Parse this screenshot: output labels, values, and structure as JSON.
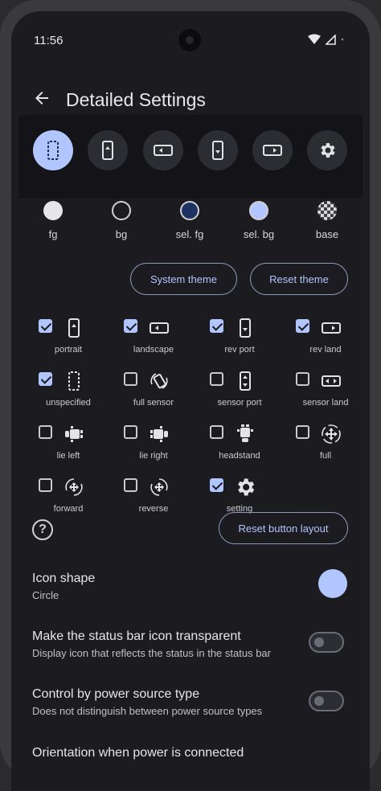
{
  "status_bar": {
    "time": "11:56"
  },
  "app_bar": {
    "title": "Detailed Settings",
    "back_icon": "arrow-back-icon"
  },
  "icon_bar": {
    "items": [
      {
        "icon": "unspecified-icon",
        "active": true
      },
      {
        "icon": "portrait-icon",
        "active": false
      },
      {
        "icon": "landscape-icon",
        "active": false
      },
      {
        "icon": "rev-port-icon",
        "active": false
      },
      {
        "icon": "rev-land-icon",
        "active": false
      },
      {
        "icon": "gear-icon",
        "active": false
      }
    ]
  },
  "colors": [
    {
      "label": "fg",
      "color": "#e6e6ea"
    },
    {
      "label": "bg",
      "color": "#1c1c20"
    },
    {
      "label": "sel. fg",
      "color": "#1d3263"
    },
    {
      "label": "sel. bg",
      "color": "#b1c5ff"
    },
    {
      "label": "base",
      "color": "checker"
    }
  ],
  "theme_buttons": {
    "system": "System theme",
    "reset": "Reset theme"
  },
  "orientations": [
    {
      "label": "portrait",
      "checked": true,
      "icon": "portrait-icon"
    },
    {
      "label": "landscape",
      "checked": true,
      "icon": "landscape-icon"
    },
    {
      "label": "rev port",
      "checked": true,
      "icon": "rev-port-icon"
    },
    {
      "label": "rev land",
      "checked": true,
      "icon": "rev-land-icon"
    },
    {
      "label": "unspecified",
      "checked": true,
      "icon": "unspecified-icon"
    },
    {
      "label": "full sensor",
      "checked": false,
      "icon": "rotate-icon"
    },
    {
      "label": "sensor port",
      "checked": false,
      "icon": "sensor-port-icon"
    },
    {
      "label": "sensor land",
      "checked": false,
      "icon": "sensor-land-icon"
    },
    {
      "label": "lie left",
      "checked": false,
      "icon": "robot-left-icon"
    },
    {
      "label": "lie right",
      "checked": false,
      "icon": "robot-right-icon"
    },
    {
      "label": "headstand",
      "checked": false,
      "icon": "robot-head-icon"
    },
    {
      "label": "full",
      "checked": false,
      "icon": "move-icon"
    },
    {
      "label": "forward",
      "checked": false,
      "icon": "forward-icon"
    },
    {
      "label": "reverse",
      "checked": false,
      "icon": "reverse-icon"
    },
    {
      "label": "setting",
      "checked": true,
      "icon": "gear-icon"
    }
  ],
  "help_icon": "?",
  "reset_layout": "Reset button layout",
  "prefs": {
    "icon_shape": {
      "title": "Icon shape",
      "value": "Circle"
    },
    "transparent": {
      "title": "Make the status bar icon transparent",
      "subtitle": "Display icon that reflects the status in the status bar",
      "enabled": false
    },
    "power": {
      "title": "Control by power source type",
      "subtitle": "Does not distinguish between power source types",
      "enabled": false
    },
    "orientation_power": {
      "title": "Orientation when power is connected"
    }
  },
  "accent": "#b1c5ff"
}
